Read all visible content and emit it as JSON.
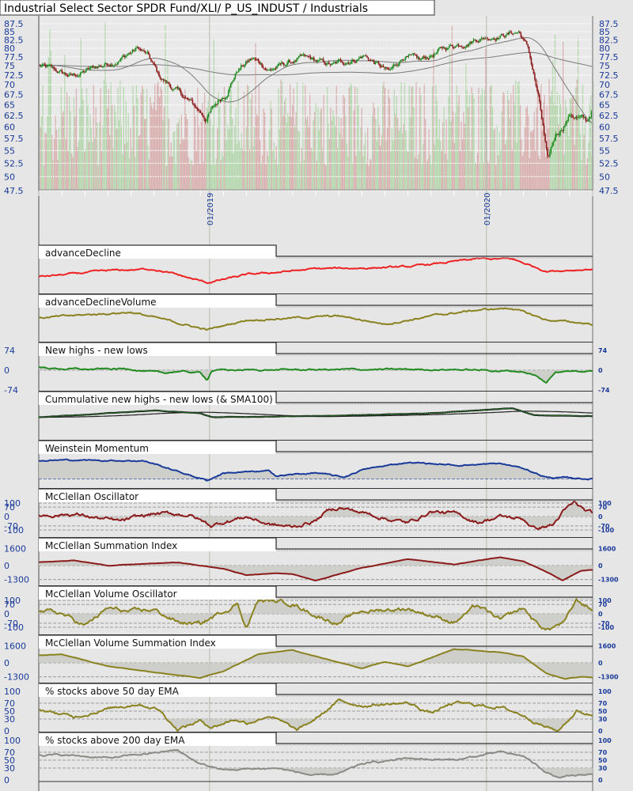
{
  "title": "Industrial Select Sector SPDR Fund/XLI/ P_US_INDUST / Industrials",
  "colors": {
    "up": "#1f8a1f",
    "down": "#8b1a1a",
    "vol_up": "#a9d3a0",
    "vol_down": "#d6a3a3",
    "axis_text": "#1a3a9a",
    "ma": "#7a7a7a"
  },
  "chart_data": {
    "type": "line",
    "x_unit": "months since 2018-05",
    "x_range": [
      0,
      24
    ],
    "x_labels": [
      {
        "month": 7.4,
        "label": "01/2019"
      },
      {
        "month": 19.4,
        "label": "01/2020"
      }
    ],
    "price": {
      "type": "candlestick",
      "ylim": [
        47.5,
        87.5
      ],
      "scale": "log",
      "ticks": [
        "87.5",
        "85",
        "82.5",
        "80",
        "77.5",
        "75",
        "72.5",
        "70",
        "67.5",
        "65",
        "62.5",
        "60",
        "57.5",
        "55",
        "52.5",
        "50",
        "47.5"
      ],
      "moving_averages": [
        50,
        200
      ],
      "keypoints": [
        [
          0,
          75
        ],
        [
          1.4,
          72
        ],
        [
          3.5,
          77
        ],
        [
          4.3,
          80
        ],
        [
          4.7,
          78
        ],
        [
          5.2,
          72
        ],
        [
          6.05,
          68
        ],
        [
          7.25,
          62
        ],
        [
          8.1,
          68
        ],
        [
          8.6,
          74
        ],
        [
          9.25,
          77
        ],
        [
          10,
          74
        ],
        [
          11.4,
          77
        ],
        [
          12.75,
          75
        ],
        [
          14.1,
          78
        ],
        [
          15.2,
          73
        ],
        [
          15.85,
          78
        ],
        [
          16.5,
          76
        ],
        [
          17.6,
          80
        ],
        [
          18.95,
          83
        ],
        [
          20.8,
          85
        ],
        [
          21.2,
          80
        ],
        [
          21.7,
          65
        ],
        [
          22.05,
          52
        ],
        [
          22.4,
          58
        ],
        [
          23.05,
          63
        ],
        [
          23.75,
          61
        ],
        [
          24,
          64
        ]
      ]
    },
    "panels": [
      {
        "title": "advanceDecline",
        "color": "#ee2222",
        "ylim": [
          0,
          100
        ],
        "ticks": [],
        "keypoints": [
          [
            0,
            40
          ],
          [
            3,
            55
          ],
          [
            5,
            60
          ],
          [
            7.3,
            25
          ],
          [
            9,
            45
          ],
          [
            12,
            60
          ],
          [
            16,
            65
          ],
          [
            19,
            85
          ],
          [
            20.5,
            85
          ],
          [
            22,
            55
          ],
          [
            24,
            60
          ]
        ],
        "noise": 3
      },
      {
        "title": "advanceDeclineVolume",
        "color": "#8a8220",
        "ylim": [
          0,
          100
        ],
        "ticks": [],
        "keypoints": [
          [
            0,
            60
          ],
          [
            4,
            75
          ],
          [
            7.3,
            30
          ],
          [
            9,
            55
          ],
          [
            11,
            60
          ],
          [
            13,
            65
          ],
          [
            15,
            45
          ],
          [
            17,
            65
          ],
          [
            19,
            80
          ],
          [
            20.5,
            85
          ],
          [
            22,
            55
          ],
          [
            24,
            45
          ]
        ],
        "noise": 3
      },
      {
        "title": "New highs - new lows",
        "color": "#228b22",
        "ylim": [
          -74,
          74
        ],
        "ticks": [
          "74",
          "0",
          "-74"
        ],
        "tick_values": [
          74,
          0,
          -74
        ],
        "dashed": [
          0
        ],
        "fill": "zero",
        "keypoints": [
          [
            0,
            8
          ],
          [
            2,
            3
          ],
          [
            4,
            5
          ],
          [
            5,
            -8
          ],
          [
            5.4,
            -12
          ],
          [
            6,
            -4
          ],
          [
            7,
            -10
          ],
          [
            7.3,
            -35
          ],
          [
            7.5,
            0
          ],
          [
            12,
            2
          ],
          [
            18,
            3
          ],
          [
            21,
            -5
          ],
          [
            21.5,
            -20
          ],
          [
            22,
            -48
          ],
          [
            22.4,
            -5
          ],
          [
            24,
            0
          ]
        ],
        "noise": 4
      },
      {
        "title": "Cummulative new highs - new lows (& SMA100)",
        "color": "#1f8a1f",
        "ylim": [
          0,
          100
        ],
        "ticks": [],
        "keypoints": [
          [
            0,
            55
          ],
          [
            5,
            72
          ],
          [
            7,
            65
          ],
          [
            7.5,
            55
          ],
          [
            12,
            58
          ],
          [
            17,
            65
          ],
          [
            20.5,
            78
          ],
          [
            21.5,
            60
          ],
          [
            24,
            58
          ]
        ],
        "noise": 0.5,
        "sma": true
      },
      {
        "title": "Weinstein Momentum",
        "color": "#1a3a9a",
        "ylim": [
          -30,
          100
        ],
        "ticks": [],
        "dashed": [
          0
        ],
        "fill": "zero",
        "keypoints": [
          [
            0,
            60
          ],
          [
            1,
            62
          ],
          [
            4.5,
            60
          ],
          [
            5,
            50
          ],
          [
            6,
            25
          ],
          [
            7.3,
            -5
          ],
          [
            8,
            20
          ],
          [
            10,
            25
          ],
          [
            10.3,
            10
          ],
          [
            12,
            20
          ],
          [
            13.2,
            5
          ],
          [
            14,
            30
          ],
          [
            16,
            55
          ],
          [
            18,
            45
          ],
          [
            20,
            50
          ],
          [
            21,
            35
          ],
          [
            22,
            5
          ],
          [
            24,
            0
          ]
        ],
        "noise": 3
      },
      {
        "title": "McClellan Oscillator",
        "color": "#8b1a1a",
        "ylim": [
          -147,
          147
        ],
        "ticks": [
          "100",
          "70",
          "0",
          "-70",
          "-100"
        ],
        "tick_values": [
          100,
          70,
          0,
          -70,
          -100
        ],
        "dashed": [
          100,
          70,
          0,
          -70,
          -100
        ],
        "fill": "zero",
        "keypoints": [
          [
            0,
            10
          ],
          [
            1.5,
            20
          ],
          [
            3.5,
            -40
          ],
          [
            5,
            20
          ],
          [
            6.5,
            15
          ],
          [
            7,
            -30
          ],
          [
            7.5,
            -70
          ],
          [
            8,
            -40
          ],
          [
            9,
            0
          ],
          [
            10,
            -60
          ],
          [
            11,
            -80
          ],
          [
            12,
            -30
          ],
          [
            12.5,
            40
          ],
          [
            13,
            70
          ],
          [
            14,
            30
          ],
          [
            16,
            -50
          ],
          [
            17,
            40
          ],
          [
            18,
            20
          ],
          [
            19,
            -40
          ],
          [
            20,
            0
          ],
          [
            21,
            -20
          ],
          [
            21.5,
            -90
          ],
          [
            22.3,
            -60
          ],
          [
            22.7,
            30
          ],
          [
            23.2,
            100
          ],
          [
            23.7,
            40
          ],
          [
            24,
            20
          ]
        ],
        "noise": 18
      },
      {
        "title": "McClellan Summation Index",
        "color": "#8b1a1a",
        "ylim": [
          -1850,
          1850
        ],
        "ticks": [
          "1600",
          "0",
          "-1300"
        ],
        "tick_values": [
          1600,
          0,
          -1300
        ],
        "dashed": [
          1600,
          0,
          -1300
        ],
        "fill": "zero",
        "keypoints": [
          [
            0,
            300
          ],
          [
            1.5,
            500
          ],
          [
            3,
            0
          ],
          [
            5,
            200
          ],
          [
            6,
            300
          ],
          [
            8,
            -300
          ],
          [
            9,
            -900
          ],
          [
            10.3,
            -700
          ],
          [
            11,
            -800
          ],
          [
            12,
            -1400
          ],
          [
            13,
            -800
          ],
          [
            14,
            -200
          ],
          [
            16,
            600
          ],
          [
            18,
            100
          ],
          [
            20,
            800
          ],
          [
            21,
            400
          ],
          [
            22,
            -600
          ],
          [
            22.7,
            -1400
          ],
          [
            23.5,
            -500
          ],
          [
            24,
            -400
          ]
        ],
        "noise": 20
      },
      {
        "title": "McClellan Volume Oscillator",
        "color": "#8a8220",
        "ylim": [
          -147,
          147
        ],
        "ticks": [
          "100",
          "70",
          "0",
          "-70",
          "-100"
        ],
        "tick_values": [
          100,
          70,
          0,
          -70,
          -100
        ],
        "dashed": [
          100,
          70,
          0,
          -70,
          -100
        ],
        "fill": "zero",
        "keypoints": [
          [
            0,
            30
          ],
          [
            1,
            0
          ],
          [
            2,
            -90
          ],
          [
            3,
            40
          ],
          [
            4,
            10
          ],
          [
            5,
            30
          ],
          [
            6,
            -60
          ],
          [
            7,
            -80
          ],
          [
            8,
            20
          ],
          [
            8.6,
            80
          ],
          [
            9,
            -100
          ],
          [
            9.5,
            100
          ],
          [
            11,
            80
          ],
          [
            12,
            -10
          ],
          [
            13,
            -70
          ],
          [
            14,
            20
          ],
          [
            16,
            40
          ],
          [
            18,
            -60
          ],
          [
            19,
            60
          ],
          [
            20,
            -50
          ],
          [
            21,
            40
          ],
          [
            21.5,
            -60
          ],
          [
            22,
            -120
          ],
          [
            22.8,
            -60
          ],
          [
            23.3,
            100
          ],
          [
            24,
            30
          ]
        ],
        "noise": 20
      },
      {
        "title": "McClellan Volume Summation Index",
        "color": "#8a8220",
        "ylim": [
          -1850,
          1850
        ],
        "ticks": [
          "1600",
          "0",
          "-1300"
        ],
        "tick_values": [
          1600,
          0,
          -1300
        ],
        "dashed": [
          1600,
          0,
          -1300
        ],
        "fill": "zero",
        "keypoints": [
          [
            0,
            700
          ],
          [
            1,
            800
          ],
          [
            3,
            -300
          ],
          [
            5,
            -900
          ],
          [
            7,
            -1400
          ],
          [
            8,
            -800
          ],
          [
            9.5,
            800
          ],
          [
            11,
            1200
          ],
          [
            12,
            600
          ],
          [
            14,
            -500
          ],
          [
            15,
            100
          ],
          [
            16,
            -300
          ],
          [
            18,
            1300
          ],
          [
            20,
            1000
          ],
          [
            21,
            600
          ],
          [
            22,
            -1000
          ],
          [
            22.8,
            -1500
          ],
          [
            23.5,
            -1300
          ],
          [
            24,
            -1400
          ]
        ],
        "noise": 25
      },
      {
        "title": "% stocks above 50 day EMA",
        "color": "#8a8220",
        "ylim": [
          0,
          100
        ],
        "ticks": [
          "100",
          "70",
          "50",
          "30",
          "0"
        ],
        "tick_values": [
          100,
          70,
          50,
          30,
          0
        ],
        "dashed": [
          70,
          50,
          30
        ],
        "fill": "bands",
        "keypoints": [
          [
            0,
            55
          ],
          [
            1.5,
            35
          ],
          [
            2.5,
            50
          ],
          [
            4.3,
            70
          ],
          [
            5.2,
            55
          ],
          [
            6,
            5
          ],
          [
            7,
            25
          ],
          [
            7.5,
            10
          ],
          [
            8.5,
            30
          ],
          [
            9,
            20
          ],
          [
            10,
            40
          ],
          [
            11.2,
            0
          ],
          [
            12,
            30
          ],
          [
            13,
            75
          ],
          [
            14,
            65
          ],
          [
            16,
            70
          ],
          [
            17,
            45
          ],
          [
            18,
            70
          ],
          [
            20,
            60
          ],
          [
            21,
            40
          ],
          [
            22,
            10
          ],
          [
            22.5,
            0
          ],
          [
            23.3,
            50
          ],
          [
            24,
            40
          ]
        ],
        "noise": 5
      },
      {
        "title": "% stocks above 200 day EMA",
        "color": "#8a8a86",
        "ylim": [
          0,
          100
        ],
        "ticks": [
          "100",
          "70",
          "50",
          "30",
          "0"
        ],
        "tick_values": [
          100,
          70,
          50,
          30,
          0
        ],
        "dashed": [
          70,
          50,
          30
        ],
        "fill": "bands",
        "keypoints": [
          [
            0,
            65
          ],
          [
            2,
            60
          ],
          [
            3,
            55
          ],
          [
            6,
            75
          ],
          [
            7,
            40
          ],
          [
            8,
            25
          ],
          [
            10.3,
            30
          ],
          [
            12,
            10
          ],
          [
            13,
            15
          ],
          [
            14,
            40
          ],
          [
            16,
            55
          ],
          [
            18,
            50
          ],
          [
            20,
            70
          ],
          [
            21,
            60
          ],
          [
            22,
            20
          ],
          [
            22.5,
            5
          ],
          [
            23.3,
            10
          ],
          [
            24,
            15
          ]
        ],
        "noise": 3
      }
    ]
  }
}
